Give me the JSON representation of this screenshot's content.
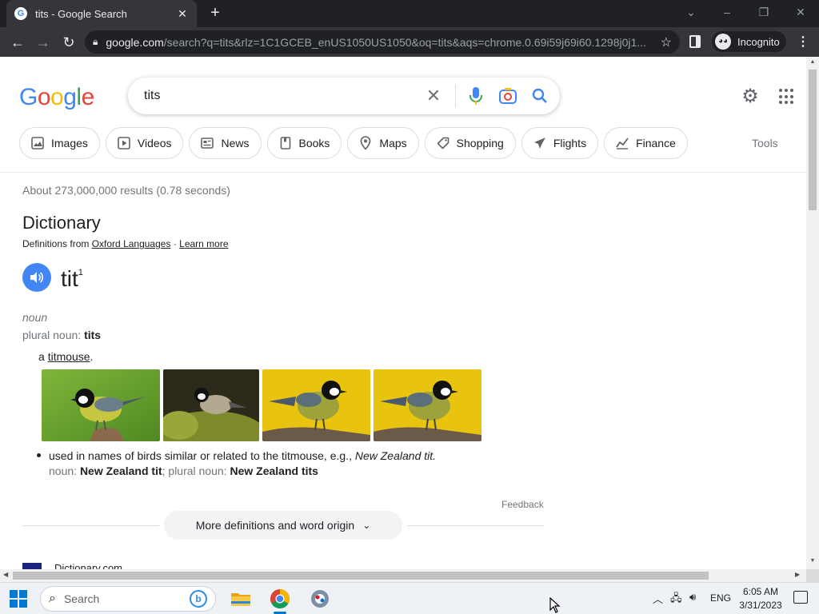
{
  "browser": {
    "tab_title": "tits - Google Search",
    "favicon_letter": "G",
    "url_host": "google.com",
    "url_rest": "/search?q=tits&rlz=1C1GCEB_enUS1050US1050&oq=tits&aqs=chrome.0.69i59j69i60.1298j0j1...",
    "incognito_label": "Incognito"
  },
  "google": {
    "logo_letters": [
      "G",
      "o",
      "o",
      "g",
      "l",
      "e"
    ],
    "query": "tits",
    "chips": [
      {
        "label": "Images",
        "icon": "image-icon"
      },
      {
        "label": "Videos",
        "icon": "play-icon"
      },
      {
        "label": "News",
        "icon": "newspaper-icon"
      },
      {
        "label": "Books",
        "icon": "book-icon"
      },
      {
        "label": "Maps",
        "icon": "map-pin-icon"
      },
      {
        "label": "Shopping",
        "icon": "tag-icon"
      },
      {
        "label": "Flights",
        "icon": "plane-icon"
      },
      {
        "label": "Finance",
        "icon": "chart-icon"
      }
    ],
    "tools_label": "Tools",
    "result_stats": "About 273,000,000 results (0.78 seconds)"
  },
  "dictionary": {
    "heading": "Dictionary",
    "source_prefix": "Definitions from",
    "source_name": "Oxford Languages",
    "source_sep": "·",
    "learn_more": "Learn more",
    "word": "tit",
    "superscript": "1",
    "part_of_speech": "noun",
    "plural_label": "plural noun:",
    "plural_value": "tits",
    "def1_prefix": "a",
    "def1_link": "titmouse",
    "def1_suffix": ".",
    "def2_text": "used in names of birds similar or related to the titmouse, e.g.,",
    "def2_example": "New Zealand tit",
    "def2_example_end": ".",
    "def2_sub_noun_label": "noun:",
    "def2_sub_noun": "New Zealand tit",
    "def2_sub_sep": ";",
    "def2_sub_plural_label": "plural noun:",
    "def2_sub_plural": "New Zealand tits",
    "feedback": "Feedback",
    "more_button": "More definitions and word origin"
  },
  "next_result": {
    "name": "Dictionary.com"
  },
  "taskbar": {
    "search_placeholder": "Search",
    "language": "ENG",
    "time": "6:05 AM",
    "date": "3/31/2023"
  },
  "colors": {
    "google_blue": "#4285f4",
    "google_red": "#ea4335",
    "google_yellow": "#fbbc05",
    "google_green": "#34a853",
    "chrome_dark": "#202124",
    "win_accent": "#0078d4"
  }
}
